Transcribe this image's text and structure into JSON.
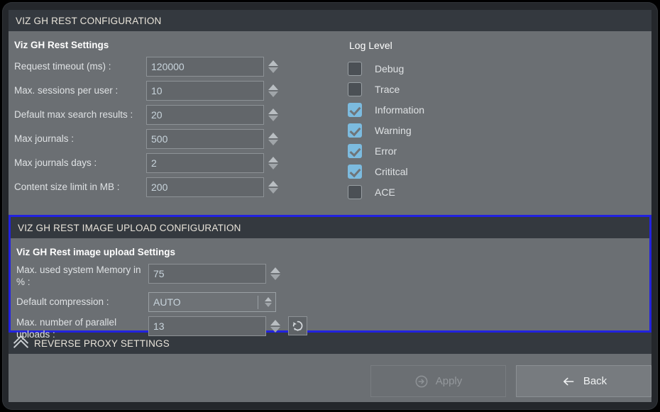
{
  "window": {
    "title": "VIZ GH REST CONFIGURATION"
  },
  "rest_config": {
    "header": "VIZ GH REST CONFIGURATION",
    "group_title": "Viz GH Rest Settings",
    "fields": [
      {
        "label": "Request timeout (ms) :",
        "value": "120000",
        "name": "request-timeout"
      },
      {
        "label": "Max. sessions per user :",
        "value": "10",
        "name": "max-sessions-per-user"
      },
      {
        "label": "Default max search results :",
        "value": "20",
        "name": "default-max-search-results"
      },
      {
        "label": "Max journals :",
        "value": "500",
        "name": "max-journals"
      },
      {
        "label": "Max journals days :",
        "value": "2",
        "name": "max-journals-days"
      },
      {
        "label": "Content size limit in MB :",
        "value": "200",
        "name": "content-size-limit-mb"
      }
    ]
  },
  "log_level": {
    "title": "Log Level",
    "items": [
      {
        "label": "Debug",
        "checked": false
      },
      {
        "label": "Trace",
        "checked": false
      },
      {
        "label": "Information",
        "checked": true
      },
      {
        "label": "Warning",
        "checked": true
      },
      {
        "label": "Error",
        "checked": true
      },
      {
        "label": "Crititcal",
        "checked": true
      },
      {
        "label": "ACE",
        "checked": false
      }
    ]
  },
  "image_upload": {
    "header": "VIZ GH REST IMAGE UPLOAD CONFIGURATION",
    "group_title": "Viz GH Rest image upload Settings",
    "highlight_color": "#2222e0",
    "fields": {
      "max_memory": {
        "label": "Max. used system Memory in % :",
        "value": "75"
      },
      "default_compression": {
        "label": "Default compression :",
        "value": "AUTO"
      },
      "max_parallel_uploads": {
        "label": "Max. number of parallel uploads :",
        "value": "13",
        "reset_icon": "reset-icon"
      }
    }
  },
  "reverse_proxy": {
    "header": "REVERSE PROXY SETTINGS",
    "chevron_icon": "chevron-up-icon"
  },
  "buttons": {
    "apply": {
      "label": "Apply",
      "icon": "arrow-right-circle-icon",
      "disabled": true
    },
    "back": {
      "label": "Back",
      "icon": "arrow-left-icon",
      "disabled": false
    }
  }
}
